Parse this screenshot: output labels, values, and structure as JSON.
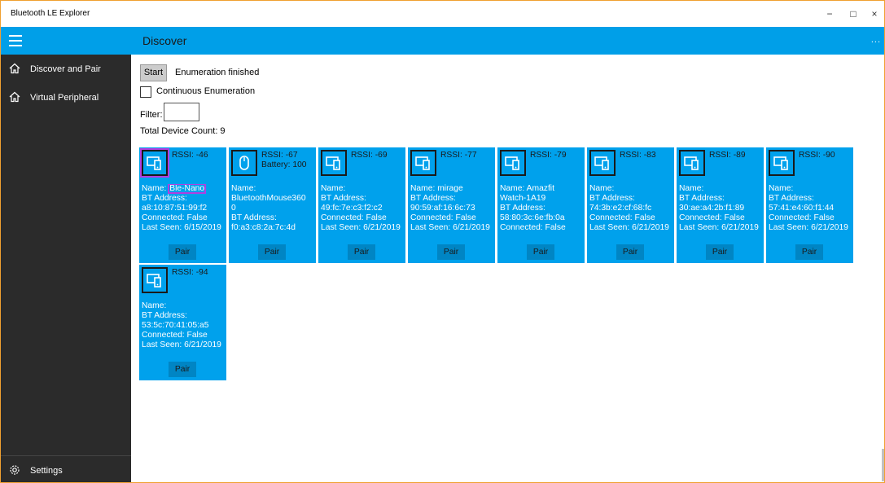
{
  "window": {
    "title": "Bluetooth LE Explorer",
    "minimize": "−",
    "maximize": "□",
    "close": "×"
  },
  "header": {
    "title": "Discover",
    "more": "..."
  },
  "sidebar": {
    "items": [
      {
        "label": "Discover and Pair",
        "icon": "home-icon"
      },
      {
        "label": "Virtual Peripheral",
        "icon": "home-icon"
      }
    ],
    "settings": {
      "label": "Settings",
      "icon": "gear-icon"
    }
  },
  "controls": {
    "start_label": "Start",
    "status": "Enumeration finished",
    "continuous_label": "Continuous Enumeration",
    "continuous_checked": false,
    "filter_label": "Filter:",
    "filter_value": "",
    "total_count": "Total Device Count: 9"
  },
  "devices": [
    {
      "rssi": "RSSI: -46",
      "battery": "",
      "name_prefix": "Name:",
      "name": "Ble-Nano",
      "addr_label": "BT Address:",
      "addr_lines": [
        "a8:10:87:51:99:f2"
      ],
      "connected": "Connected: False",
      "last_seen": "Last Seen: 6/15/2019",
      "pair": "Pair",
      "type": "device"
    },
    {
      "rssi": "RSSI: -67",
      "battery": "Battery: 100",
      "name_prefix": "Name:",
      "name": "",
      "name_lines": [
        "BluetoothMouse360",
        "0"
      ],
      "addr_label": "BT Address:",
      "addr_lines": [
        "f0:a3:c8:2a:7c:4d"
      ],
      "connected": "",
      "last_seen": "",
      "pair": "Pair",
      "type": "mouse"
    },
    {
      "rssi": "RSSI: -69",
      "battery": "",
      "name_prefix": "Name:",
      "name": "",
      "addr_label": "BT Address:",
      "addr_lines": [
        "49:fc:7e:c3:f2:c2"
      ],
      "connected": "Connected: False",
      "last_seen": "Last Seen: 6/21/2019",
      "pair": "Pair",
      "type": "device"
    },
    {
      "rssi": "RSSI: -77",
      "battery": "",
      "name_prefix": "Name:",
      "name": "mirage",
      "addr_label": "BT Address:",
      "addr_lines": [
        "90:59:af:16:6c:73"
      ],
      "connected": "Connected: False",
      "last_seen": "Last Seen: 6/21/2019",
      "pair": "Pair",
      "type": "device"
    },
    {
      "rssi": "RSSI: -79",
      "battery": "",
      "name_prefix": "Name:",
      "name": "Amazfit",
      "name_lines": [
        "Watch-1A19"
      ],
      "addr_label": "BT Address:",
      "addr_lines": [
        "58:80:3c:6e:fb:0a"
      ],
      "connected": "Connected: False",
      "last_seen": "",
      "pair": "Pair",
      "type": "device"
    },
    {
      "rssi": "RSSI: -83",
      "battery": "",
      "name_prefix": "Name:",
      "name": "",
      "addr_label": "BT Address:",
      "addr_lines": [
        "74:3b:e2:cf:68:fc"
      ],
      "connected": "Connected: False",
      "last_seen": "Last Seen: 6/21/2019",
      "pair": "Pair",
      "type": "device"
    },
    {
      "rssi": "RSSI: -89",
      "battery": "",
      "name_prefix": "Name:",
      "name": "",
      "addr_label": "BT Address:",
      "addr_lines": [
        "30:ae:a4:2b:f1:89"
      ],
      "connected": "Connected: False",
      "last_seen": "Last Seen: 6/21/2019",
      "pair": "Pair",
      "type": "device"
    },
    {
      "rssi": "RSSI: -90",
      "battery": "",
      "name_prefix": "Name:",
      "name": "",
      "addr_label": "BT Address:",
      "addr_lines": [
        "57:41:e4:60:f1:44"
      ],
      "connected": "Connected: False",
      "last_seen": "Last Seen: 6/21/2019",
      "pair": "Pair",
      "type": "device"
    },
    {
      "rssi": "RSSI: -94",
      "battery": "",
      "name_prefix": "Name:",
      "name": "",
      "addr_label": "BT Address:",
      "addr_lines": [
        "53:5c:70:41:05:a5"
      ],
      "connected": "Connected: False",
      "last_seen": "Last Seen: 6/21/2019",
      "pair": "Pair",
      "type": "device"
    }
  ],
  "colors": {
    "accent": "#009fe8",
    "card": "#00a1ec",
    "pair_button": "#0085c4",
    "sidebar": "#2b2b2b",
    "highlight": "#b03fe0"
  }
}
